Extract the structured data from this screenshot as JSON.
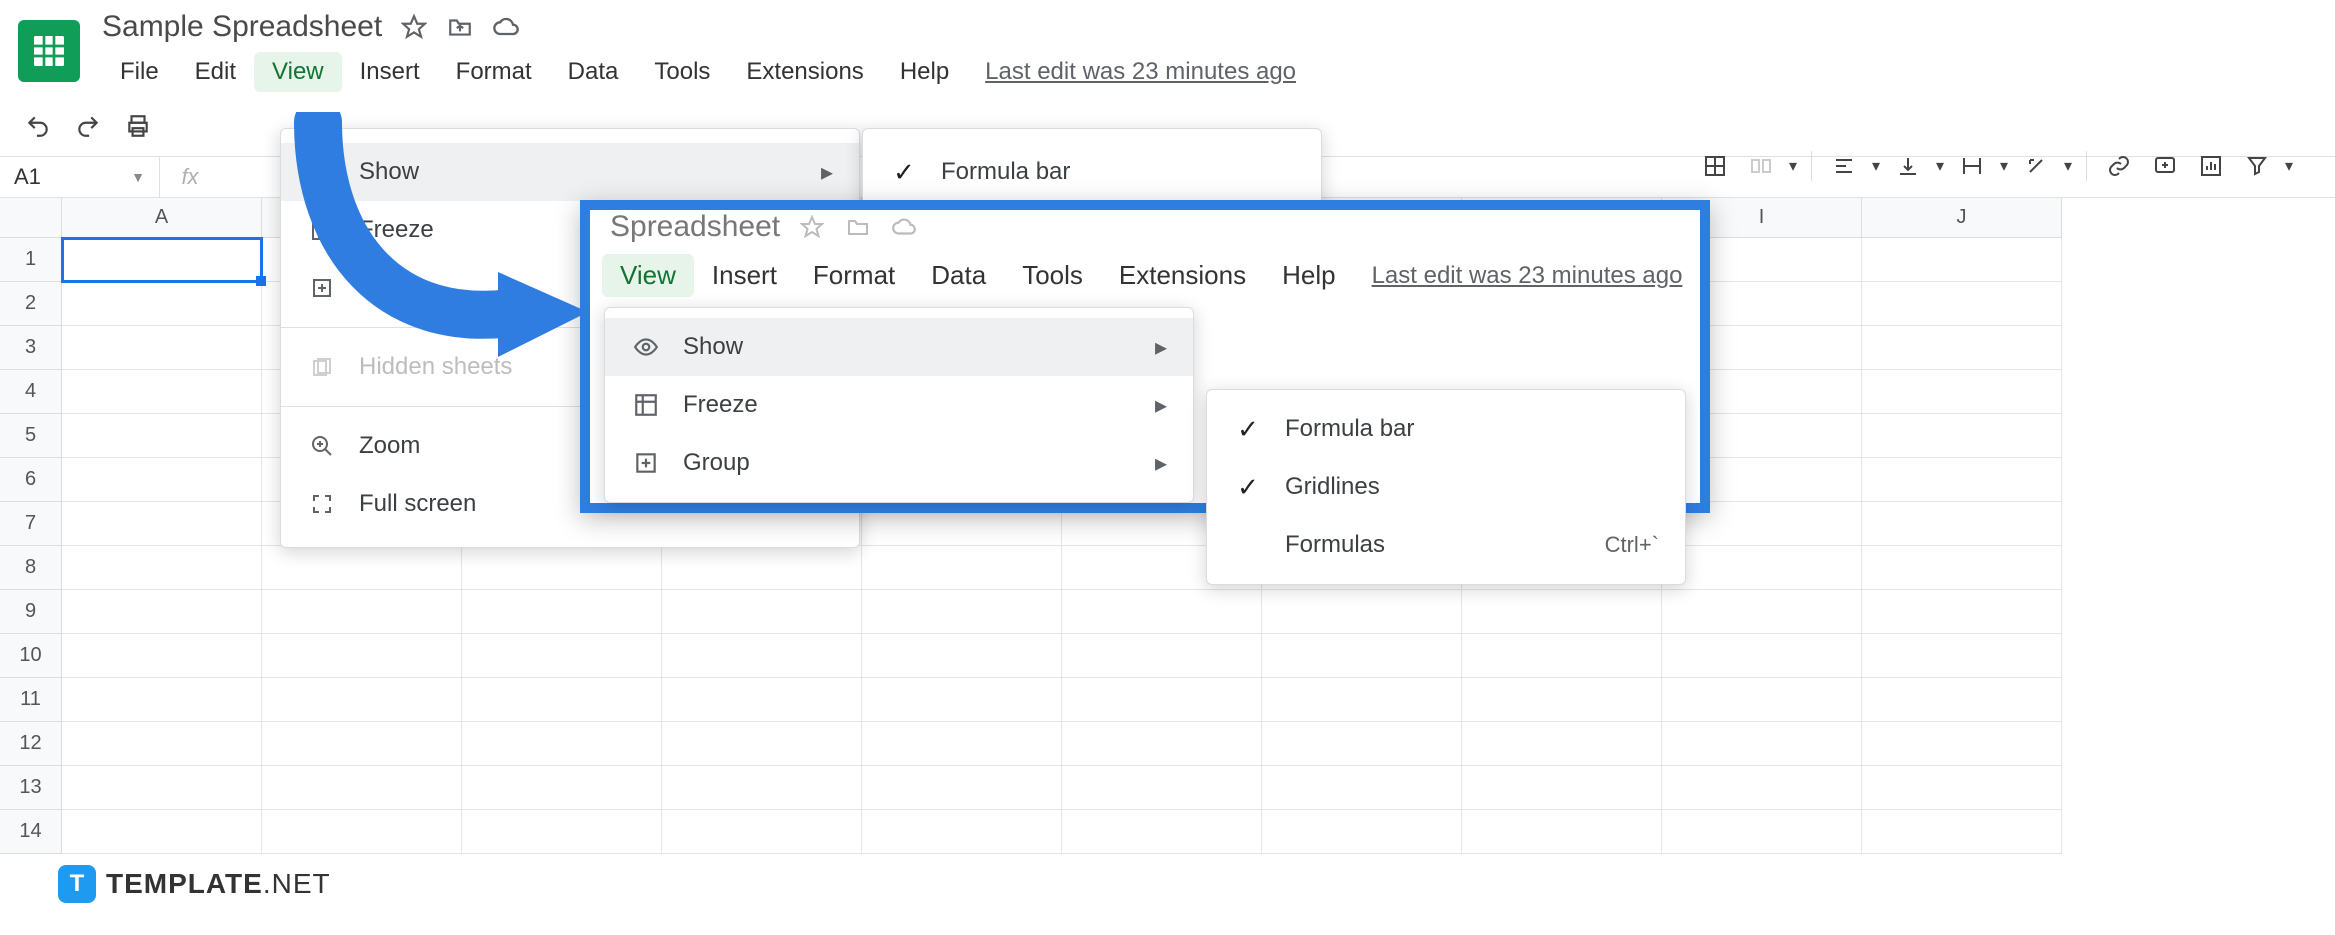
{
  "doc": {
    "title": "Sample Spreadsheet"
  },
  "menus": {
    "file": "File",
    "edit": "Edit",
    "view": "View",
    "insert": "Insert",
    "format": "Format",
    "data": "Data",
    "tools": "Tools",
    "extensions": "Extensions",
    "help": "Help",
    "last_edit": "Last edit was 23 minutes ago"
  },
  "name_box": {
    "value": "A1"
  },
  "columns": [
    "A",
    "B",
    "C",
    "D",
    "E",
    "F",
    "G",
    "H",
    "I",
    "J"
  ],
  "rows": [
    "1",
    "2",
    "3",
    "4",
    "5",
    "6",
    "7",
    "8",
    "9",
    "10",
    "11",
    "12",
    "13",
    "14"
  ],
  "view_menu": {
    "show": "Show",
    "freeze": "Freeze",
    "group": "Group",
    "hidden_sheets": "Hidden sheets",
    "zoom": "Zoom",
    "full_screen": "Full screen"
  },
  "show_submenu": {
    "formula_bar": "Formula bar",
    "gridlines": "Gridlines",
    "formulas": "Formulas",
    "formulas_shortcut": "Ctrl+`"
  },
  "zoom_overlay": {
    "title_fragment": "Spreadsheet"
  },
  "watermark": {
    "brand": "TEMPLATE",
    "suffix": ".NET",
    "badge": "T"
  }
}
